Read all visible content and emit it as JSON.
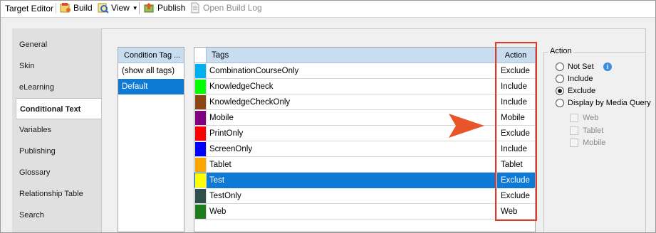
{
  "toolbar": {
    "title": "Target Editor",
    "build_label": "Build",
    "view_label": "View",
    "publish_label": "Publish",
    "open_build_log_label": "Open Build Log"
  },
  "tabs": [
    {
      "label": "General",
      "active": false
    },
    {
      "label": "Skin",
      "active": false
    },
    {
      "label": "eLearning",
      "active": false
    },
    {
      "label": "Conditional Text",
      "active": true
    },
    {
      "label": "Variables",
      "active": false
    },
    {
      "label": "Publishing",
      "active": false
    },
    {
      "label": "Glossary",
      "active": false
    },
    {
      "label": "Relationship Table",
      "active": false
    },
    {
      "label": "Search",
      "active": false
    }
  ],
  "condition_tag_sets": {
    "header": "Condition Tag ...",
    "items": [
      {
        "label": "(show all tags)",
        "selected": false
      },
      {
        "label": "Default",
        "selected": true
      }
    ]
  },
  "tags_grid": {
    "header_tags": "Tags",
    "header_action": "Action",
    "rows": [
      {
        "name": "CombinationCourseOnly",
        "color": "#00b0f0",
        "action": "Exclude",
        "selected": false
      },
      {
        "name": "KnowledgeCheck",
        "color": "#00ff00",
        "action": "Include",
        "selected": false
      },
      {
        "name": "KnowledgeCheckOnly",
        "color": "#8b4513",
        "action": "Include",
        "selected": false
      },
      {
        "name": "Mobile",
        "color": "#800080",
        "action": "Mobile",
        "selected": false
      },
      {
        "name": "PrintOnly",
        "color": "#ff0000",
        "action": "Exclude",
        "selected": false
      },
      {
        "name": "ScreenOnly",
        "color": "#0000ff",
        "action": "Include",
        "selected": false
      },
      {
        "name": "Tablet",
        "color": "#ffa500",
        "action": "Tablet",
        "selected": false
      },
      {
        "name": "Test",
        "color": "#ffff00",
        "action": "Exclude",
        "selected": true
      },
      {
        "name": "TestOnly",
        "color": "#ff00ff",
        "action": "Exclude",
        "selected": false
      },
      {
        "name": "Web",
        "color": "#1e7b1e",
        "action": "Web",
        "selected": false
      }
    ]
  },
  "extra_row_colors": {
    "testonly_swatch": "#2f4f4f"
  },
  "action_group": {
    "title": "Action",
    "options": [
      {
        "label": "Not Set",
        "checked": false
      },
      {
        "label": "Include",
        "checked": false
      },
      {
        "label": "Exclude",
        "checked": true
      },
      {
        "label": "Display by Media Query",
        "checked": false
      }
    ],
    "media": [
      {
        "label": "Web"
      },
      {
        "label": "Tablet"
      },
      {
        "label": "Mobile"
      }
    ]
  },
  "colors": {
    "highlight": "#e03a2a",
    "selection": "#0f7ad6",
    "header": "#c9ddf1"
  }
}
